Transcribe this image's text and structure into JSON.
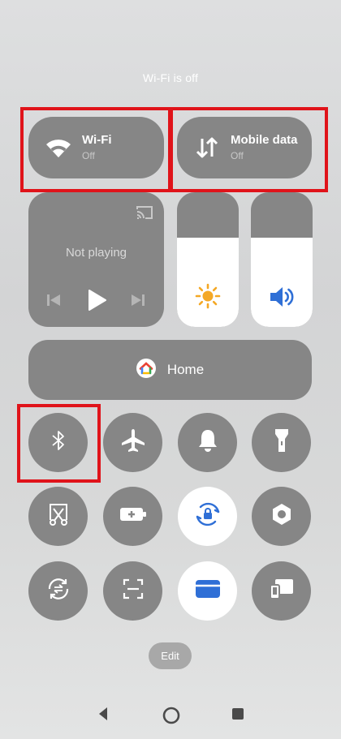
{
  "status_text": "Wi-Fi is off",
  "tiles": {
    "wifi": {
      "title": "Wi-Fi",
      "state": "Off",
      "icon": "wifi-icon"
    },
    "mobile_data": {
      "title": "Mobile data",
      "state": "Off",
      "icon": "mobile-data-icon"
    }
  },
  "media": {
    "status": "Not playing",
    "icons": [
      "cast-icon",
      "previous-icon",
      "play-icon",
      "next-icon"
    ]
  },
  "sliders": {
    "brightness": {
      "icon": "brightness-icon",
      "level": 0.66,
      "accent": "#f4a825"
    },
    "volume": {
      "icon": "volume-icon",
      "level": 0.66,
      "accent": "#2f6fd6"
    }
  },
  "home": {
    "label": "Home",
    "icon": "google-home-icon"
  },
  "toggles": [
    {
      "name": "bluetooth",
      "icon": "bluetooth-icon",
      "active": false
    },
    {
      "name": "airplane-mode",
      "icon": "airplane-icon",
      "active": false
    },
    {
      "name": "sound",
      "icon": "bell-icon",
      "active": false
    },
    {
      "name": "flashlight",
      "icon": "flashlight-icon",
      "active": false
    },
    {
      "name": "screenshot",
      "icon": "scissors-icon",
      "active": false
    },
    {
      "name": "battery-saver",
      "icon": "battery-icon",
      "active": false
    },
    {
      "name": "rotation-lock",
      "icon": "rotation-lock-icon",
      "active": true
    },
    {
      "name": "settings",
      "icon": "settings-icon",
      "active": false
    },
    {
      "name": "data-saver",
      "icon": "data-saver-icon",
      "active": false
    },
    {
      "name": "scanner",
      "icon": "scan-icon",
      "active": false
    },
    {
      "name": "wallet",
      "icon": "wallet-icon",
      "active": true
    },
    {
      "name": "device-connect",
      "icon": "devices-icon",
      "active": false
    }
  ],
  "edit_label": "Edit",
  "colors": {
    "tile_bg": "#868686",
    "highlight": "#e0131a",
    "accent_blue": "#2f6fd6"
  },
  "nav": [
    "back-icon",
    "home-nav-icon",
    "recents-icon"
  ]
}
